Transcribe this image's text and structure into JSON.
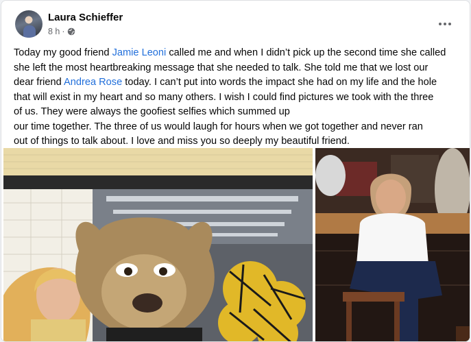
{
  "post": {
    "author": "Laura Schieffer",
    "timestamp": "8 h",
    "separator": "·",
    "audience_icon": "globe-icon",
    "more_icon": "more-options-icon",
    "text_lines": [
      [
        "Today my good friend ",
        "Jamie Leoni",
        " called me and when I didn’t pick up the second time she called"
      ],
      [
        "she left the most heartbreaking message that she needed to talk.  She told me that we lost our"
      ],
      [
        "dear friend ",
        "Andrea Rose",
        " today.  I can’t put into words the impact she had on my life and the hole"
      ],
      [
        "that will exist in my heart and so many others.  I wish I could find pictures we took with the three"
      ],
      [
        "of us. They were always the goofiest selfies which summed up"
      ],
      [
        "our time together.  The three of us would laugh for hours when we got together and never ran"
      ],
      [
        "out of things to talk about.  I love and miss you so deeply my beautiful friend."
      ]
    ],
    "mentions": [
      "Jamie Leoni",
      "Andrea Rose"
    ],
    "mention_color": "#216fdb"
  }
}
